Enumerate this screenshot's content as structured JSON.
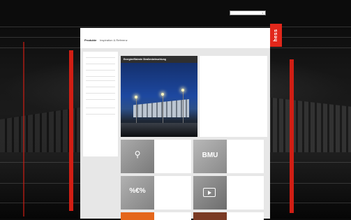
{
  "brand": {
    "accent_red": "#d01e14",
    "logo_red": "#e2271b"
  },
  "topbar": {
    "site_label": "",
    "language_select": {
      "value": "",
      "icon": "chevron-down-icon"
    }
  },
  "header": {
    "logo_text": "hess",
    "tabs": [
      {
        "label": "Produkte"
      },
      {
        "label": "Inspiration & Referenz"
      }
    ],
    "links": [
      {
        "label": ""
      },
      {
        "label": ""
      },
      {
        "label": ""
      },
      {
        "label": ""
      }
    ]
  },
  "sidebar": {
    "title": "",
    "items": [
      {
        "label": ""
      },
      {
        "label": ""
      },
      {
        "label": ""
      },
      {
        "label": ""
      },
      {
        "label": ""
      },
      {
        "label": ""
      },
      {
        "label": ""
      },
      {
        "label": ""
      },
      {
        "label": ""
      },
      {
        "label": ""
      }
    ]
  },
  "hero": {
    "title": "Energieeffiziente Straßenbeleuchtung",
    "image_alt": "night-photo-office-building",
    "intro": "",
    "heading": "",
    "body": ""
  },
  "tiles": [
    {
      "title": "",
      "text": "",
      "thumb_label": "",
      "thumb_icon": "lamp-icon"
    },
    {
      "title": "",
      "text": "",
      "thumb_label": "BMU",
      "thumb_icon": ""
    },
    {
      "title": "",
      "text": "",
      "thumb_label": "%€%",
      "thumb_icon": ""
    },
    {
      "title": "",
      "text": "",
      "thumb_label": "",
      "thumb_icon": "play-icon"
    }
  ]
}
